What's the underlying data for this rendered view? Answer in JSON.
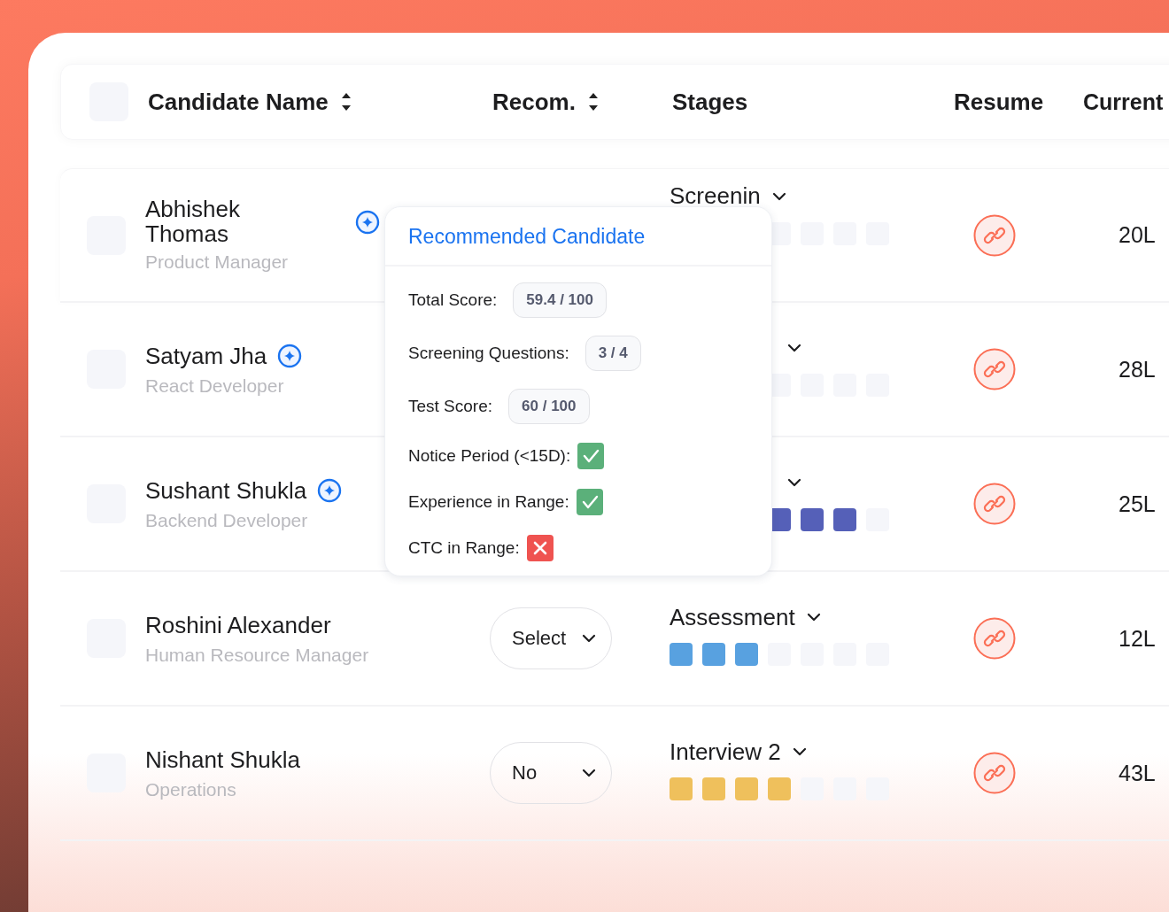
{
  "table": {
    "columns": [
      {
        "label": "Candidate Name",
        "sortable": true
      },
      {
        "label": "Recom.",
        "sortable": true
      },
      {
        "label": "Stages",
        "sortable": false
      },
      {
        "label": "Resume",
        "sortable": false
      },
      {
        "label": "Current",
        "sortable": false
      }
    ],
    "header_checkbox": {
      "checked": false
    },
    "rows": [
      {
        "checked": false,
        "name": "Abhishek Thomas",
        "role": "Product Manager",
        "recommended": true,
        "stage": {
          "label": "Screenin",
          "steps": [
            false,
            false,
            false,
            false
          ]
        },
        "current": "20L"
      },
      {
        "checked": false,
        "name": "Satyam Jha",
        "role": "React Developer",
        "recommended": true,
        "stage": {
          "steps": [
            false,
            false,
            false,
            false
          ]
        },
        "current": "28L"
      },
      {
        "checked": false,
        "name": "Sushant Shukla",
        "role": "Backend Developer",
        "recommended": true,
        "stage": {
          "color": "#5560b8",
          "steps": [
            true,
            true,
            true,
            false
          ]
        },
        "current": "25L"
      },
      {
        "checked": false,
        "name": "Roshini Alexander",
        "role": "Human Resource Manager",
        "recommended": false,
        "recom": "Select",
        "stage": {
          "label": "Assessment",
          "color": "#58a1e0",
          "steps": [
            true,
            true,
            true,
            false,
            false,
            false,
            false
          ]
        },
        "current": "12L"
      },
      {
        "checked": false,
        "name": "Nishant Shukla",
        "role": "Operations",
        "recommended": false,
        "recom": "No",
        "stage": {
          "label": "Interview 2",
          "color": "#efc05c",
          "steps": [
            true,
            true,
            true,
            true,
            false,
            false,
            false
          ]
        },
        "current": "43L"
      }
    ]
  },
  "popover": {
    "title": "Recommended Candidate",
    "items": [
      {
        "kind": "score",
        "label": "Total Score:",
        "value": "59.4 / 100"
      },
      {
        "kind": "score",
        "label": "Screening Questions:",
        "value": "3 / 4"
      },
      {
        "kind": "score",
        "label": "Test Score:",
        "value": "60 / 100"
      },
      {
        "kind": "check",
        "label": "Notice Period (<15D):",
        "passed": true
      },
      {
        "kind": "check",
        "label": "Experience in Range:",
        "passed": true
      },
      {
        "kind": "check",
        "label": "CTC in Range:",
        "passed": false
      }
    ]
  }
}
